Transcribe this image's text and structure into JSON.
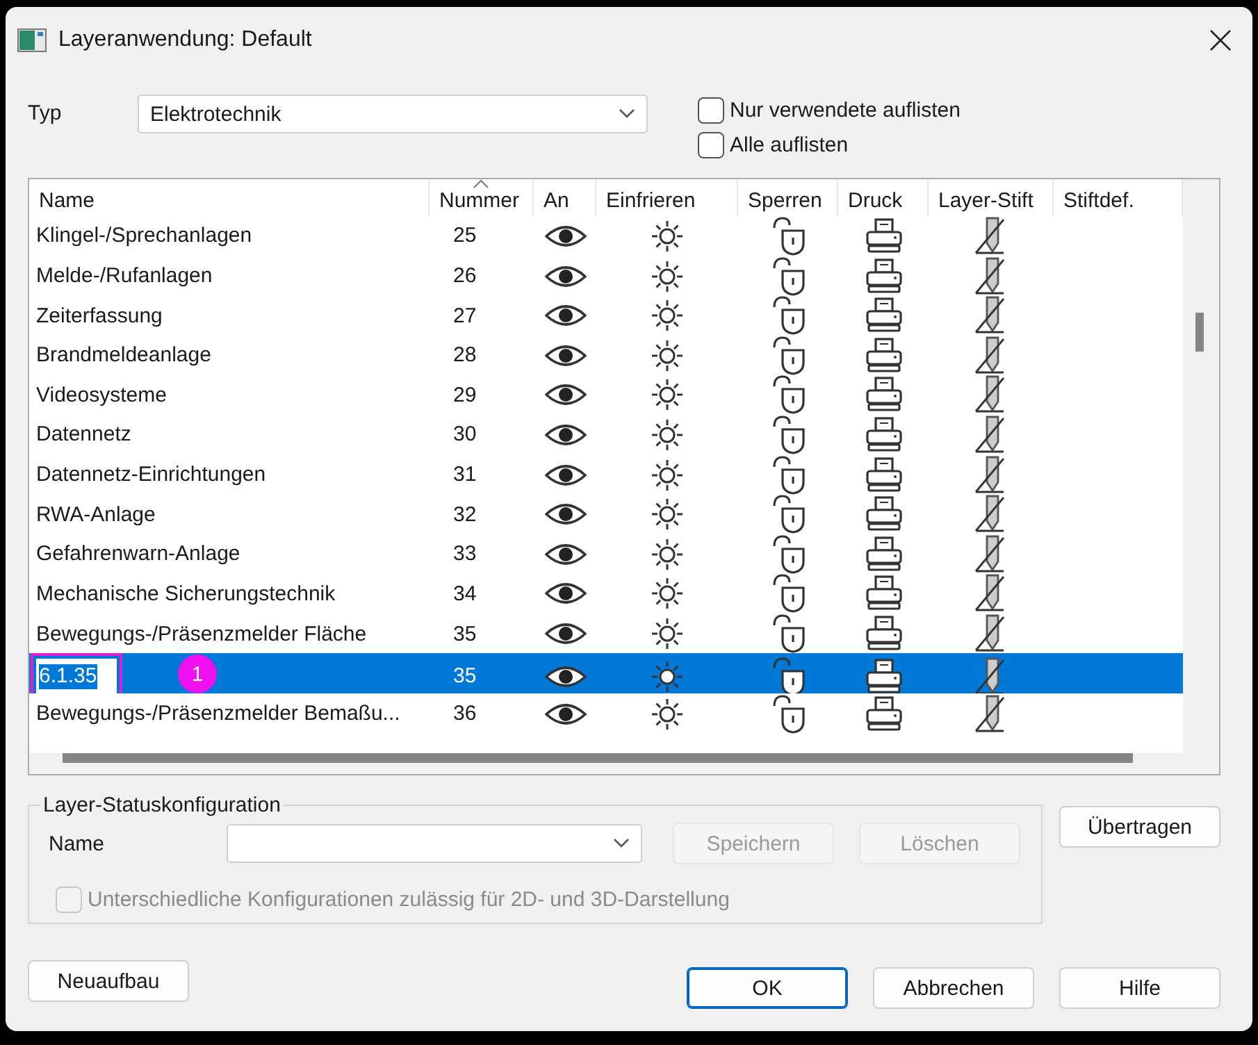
{
  "window": {
    "title": "Layeranwendung: Default"
  },
  "typ": {
    "label": "Typ",
    "value": "Elektrotechnik"
  },
  "filters": [
    {
      "label": "Nur verwendete auflisten",
      "checked": false
    },
    {
      "label": "Alle auflisten",
      "checked": false
    }
  ],
  "table": {
    "columns": [
      {
        "label": "Name",
        "sorted": false
      },
      {
        "label": "Nummer",
        "sorted": true
      },
      {
        "label": "An",
        "sorted": false
      },
      {
        "label": "Einfrieren",
        "sorted": false
      },
      {
        "label": "Sperren",
        "sorted": false
      },
      {
        "label": "Druck",
        "sorted": false
      },
      {
        "label": "Layer-Stift",
        "sorted": false
      },
      {
        "label": "Stiftdef.",
        "sorted": false
      }
    ],
    "rows": [
      {
        "name": "Klingel-/Sprechanlagen",
        "number": "25",
        "selected": false,
        "editing": false
      },
      {
        "name": "Melde-/Rufanlagen",
        "number": "26",
        "selected": false,
        "editing": false
      },
      {
        "name": "Zeiterfassung",
        "number": "27",
        "selected": false,
        "editing": false
      },
      {
        "name": "Brandmeldeanlage",
        "number": "28",
        "selected": false,
        "editing": false
      },
      {
        "name": "Videosysteme",
        "number": "29",
        "selected": false,
        "editing": false
      },
      {
        "name": "Datennetz",
        "number": "30",
        "selected": false,
        "editing": false
      },
      {
        "name": "Datennetz-Einrichtungen",
        "number": "31",
        "selected": false,
        "editing": false
      },
      {
        "name": "RWA-Anlage",
        "number": "32",
        "selected": false,
        "editing": false
      },
      {
        "name": "Gefahrenwarn-Anlage",
        "number": "33",
        "selected": false,
        "editing": false
      },
      {
        "name": "Mechanische Sicherungstechnik",
        "number": "34",
        "selected": false,
        "editing": false
      },
      {
        "name": "Bewegungs-/Präsenzmelder Fläche",
        "number": "35",
        "selected": false,
        "editing": false
      },
      {
        "name": "6.1.35",
        "number": "35",
        "selected": true,
        "editing": true,
        "annotation": "1"
      },
      {
        "name": "Bewegungs-/Präsenzmelder Bemaßu...",
        "number": "36",
        "selected": false,
        "editing": false
      }
    ]
  },
  "status_config": {
    "title": "Layer-Statuskonfiguration",
    "name_label": "Name",
    "buttons": [
      {
        "label": "Speichern",
        "disabled": true
      },
      {
        "label": "Löschen",
        "disabled": true
      }
    ],
    "option": {
      "label": "Unterschiedliche Konfigurationen zulässig für 2D- und 3D-Darstellung",
      "checked": false,
      "disabled": true
    }
  },
  "transfer_button": "Übertragen",
  "rebuild_button": "Neuaufbau",
  "buttons": [
    {
      "label": "OK",
      "default": true
    },
    {
      "label": "Abbrechen",
      "default": false
    },
    {
      "label": "Hilfe",
      "default": false
    }
  ]
}
